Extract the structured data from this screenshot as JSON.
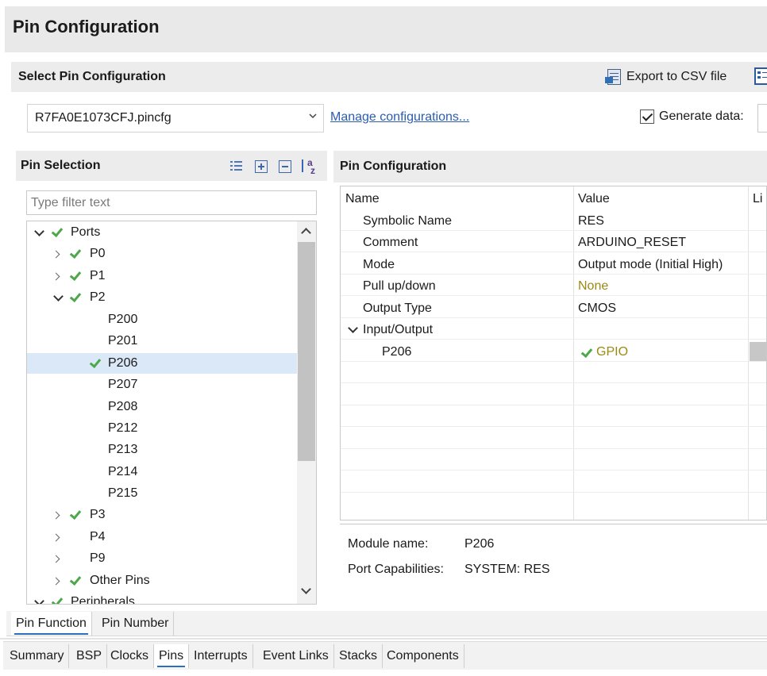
{
  "window": {
    "title": "Pin Configuration"
  },
  "select_config": {
    "heading": "Select Pin Configuration",
    "export_label": "Export to CSV file",
    "file_value": "R7FA0E1073CFJ.pincfg",
    "manage_link": "Manage configurations...",
    "generate_label": "Generate data:",
    "generate_checked": true
  },
  "pin_selection": {
    "heading": "Pin Selection",
    "filter_placeholder": "Type filter text",
    "tree": [
      {
        "label": "Ports",
        "expanded": true,
        "checked": true
      },
      {
        "label": "P0",
        "expanded": false,
        "checked": true
      },
      {
        "label": "P1",
        "expanded": false,
        "checked": true
      },
      {
        "label": "P2",
        "expanded": true,
        "checked": true
      },
      {
        "label": "P200"
      },
      {
        "label": "P201"
      },
      {
        "label": "P206",
        "checked": true,
        "selected": true
      },
      {
        "label": "P207"
      },
      {
        "label": "P208"
      },
      {
        "label": "P212"
      },
      {
        "label": "P213"
      },
      {
        "label": "P214"
      },
      {
        "label": "P215"
      },
      {
        "label": "P3",
        "expanded": false,
        "checked": true
      },
      {
        "label": "P4",
        "expanded": false
      },
      {
        "label": "P9",
        "expanded": false
      },
      {
        "label": "Other Pins",
        "expanded": false,
        "checked": true
      },
      {
        "label": "Peripherals",
        "expanded": true,
        "checked": true
      }
    ]
  },
  "pin_configuration": {
    "heading": "Pin Configuration",
    "columns": {
      "name": "Name",
      "value": "Value",
      "third": "Li"
    },
    "rows": [
      {
        "name": "Symbolic Name",
        "value": "RES"
      },
      {
        "name": "Comment",
        "value": "ARDUINO_RESET"
      },
      {
        "name": "Mode",
        "value": "Output mode (Initial High)"
      },
      {
        "name": "Pull up/down",
        "value": "None"
      },
      {
        "name": "Output Type",
        "value": "CMOS"
      },
      {
        "name": "Input/Output",
        "value": ""
      },
      {
        "name": "P206",
        "value": "GPIO"
      }
    ],
    "module_name_label": "Module name:",
    "module_name_value": "P206",
    "port_cap_label": "Port Capabilities:",
    "port_cap_value": "SYSTEM: RES"
  },
  "view_tabs": [
    {
      "label": "Pin Function",
      "active": true
    },
    {
      "label": "Pin Number",
      "active": false
    }
  ],
  "editor_tabs": [
    {
      "label": "Summary"
    },
    {
      "label": "BSP"
    },
    {
      "label": "Clocks"
    },
    {
      "label": "Pins",
      "active": true
    },
    {
      "label": "Interrupts"
    },
    {
      "label": "Event Links"
    },
    {
      "label": "Stacks"
    },
    {
      "label": "Components"
    }
  ],
  "colors": {
    "check_green": "#4ca84a",
    "link_blue": "#2a5db0",
    "olive_value": "#9a8a14",
    "selection": "#dbe8f7"
  }
}
